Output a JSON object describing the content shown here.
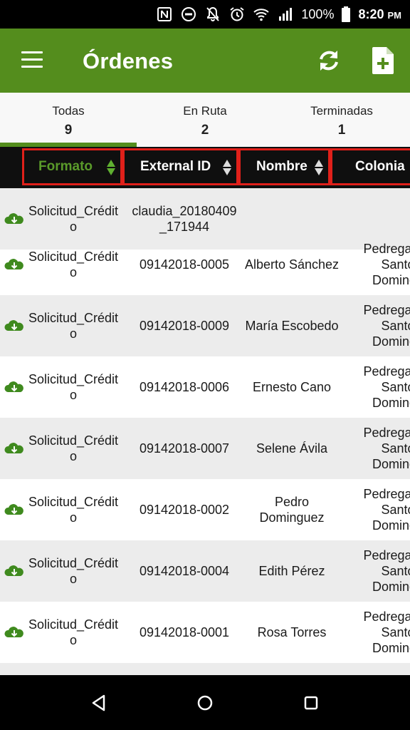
{
  "status_bar": {
    "battery": "100%",
    "time": "8:20",
    "ampm": "PM",
    "icons": [
      "nfc-icon",
      "do-not-disturb-icon",
      "notifications-off-icon",
      "alarm-icon",
      "wifi-icon",
      "signal-icon",
      "battery-icon"
    ]
  },
  "app_bar": {
    "title": "Órdenes",
    "color": "#548d1d",
    "actions": [
      "refresh-icon",
      "new-document-icon"
    ]
  },
  "tabs": [
    {
      "label": "Todas",
      "count": "9",
      "selected": true
    },
    {
      "label": "En Ruta",
      "count": "2",
      "selected": false
    },
    {
      "label": "Terminadas",
      "count": "1",
      "selected": false
    }
  ],
  "table": {
    "headers": [
      "Formato",
      "External ID",
      "Nombre",
      "Colonia"
    ],
    "active_sort_column": "Formato",
    "rows": [
      {
        "formato": "Solicitud_Crédito",
        "external_id": "claudia_20180409_171944",
        "nombre": "",
        "colonia": ""
      },
      {
        "formato": "Solicitud_Crédito",
        "external_id": "09142018-0005",
        "nombre": "Alberto Sánchez",
        "colonia": "Pedregal de Santo Domingo"
      },
      {
        "formato": "Solicitud_Crédito",
        "external_id": "09142018-0009",
        "nombre": "María Escobedo",
        "colonia": "Pedregal de Santo Domingo"
      },
      {
        "formato": "Solicitud_Crédito",
        "external_id": "09142018-0006",
        "nombre": "Ernesto Cano",
        "colonia": "Pedregal de Santo Domingo"
      },
      {
        "formato": "Solicitud_Crédito",
        "external_id": "09142018-0007",
        "nombre": "Selene Ávila",
        "colonia": "Pedregal de Santo Domingo"
      },
      {
        "formato": "Solicitud_Crédito",
        "external_id": "09142018-0002",
        "nombre": "Pedro Dominguez",
        "colonia": "Pedregal de Santo Domingo"
      },
      {
        "formato": "Solicitud_Crédito",
        "external_id": "09142018-0004",
        "nombre": "Edith Pérez",
        "colonia": "Pedregal de Santo Domingo"
      },
      {
        "formato": "Solicitud_Crédito",
        "external_id": "09142018-0001",
        "nombre": "Rosa Torres",
        "colonia": "Pedregal de Santo Domingo"
      }
    ]
  },
  "nav_bar": {
    "buttons": [
      "back-icon",
      "home-icon",
      "recents-icon"
    ]
  }
}
